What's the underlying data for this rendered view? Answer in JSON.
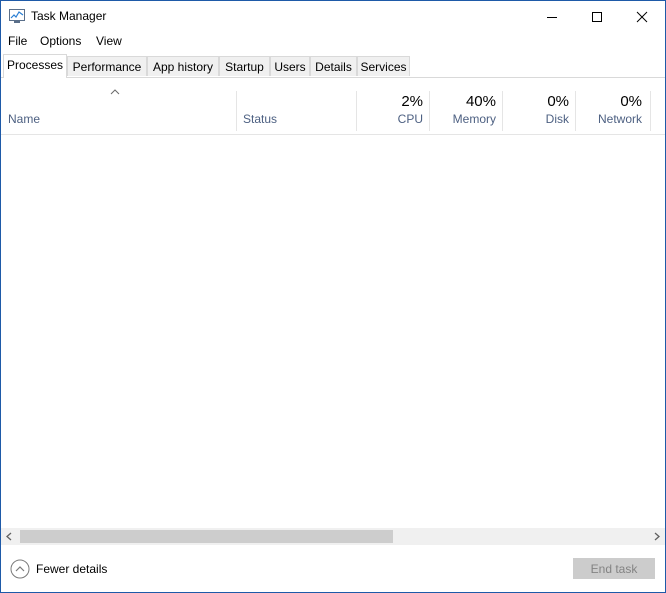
{
  "window": {
    "title": "Task Manager"
  },
  "menu": [
    "File",
    "Options",
    "View"
  ],
  "tabs": [
    "Processes",
    "Performance",
    "App history",
    "Startup",
    "Users",
    "Details",
    "Services"
  ],
  "columns": {
    "name": {
      "label": "Name"
    },
    "status": {
      "label": "Status"
    },
    "cpu": {
      "label": "CPU",
      "value": "2%"
    },
    "memory": {
      "label": "Memory",
      "value": "40%"
    },
    "disk": {
      "label": "Disk",
      "value": "0%"
    },
    "network": {
      "label": "Network",
      "value": "0%"
    }
  },
  "footer": {
    "fewer_details": "Fewer details",
    "end_task": "End task"
  },
  "colors": {
    "window_border": "#1e5aa8",
    "column_label": "#4d6082",
    "disabled_button": "#cccccc"
  }
}
